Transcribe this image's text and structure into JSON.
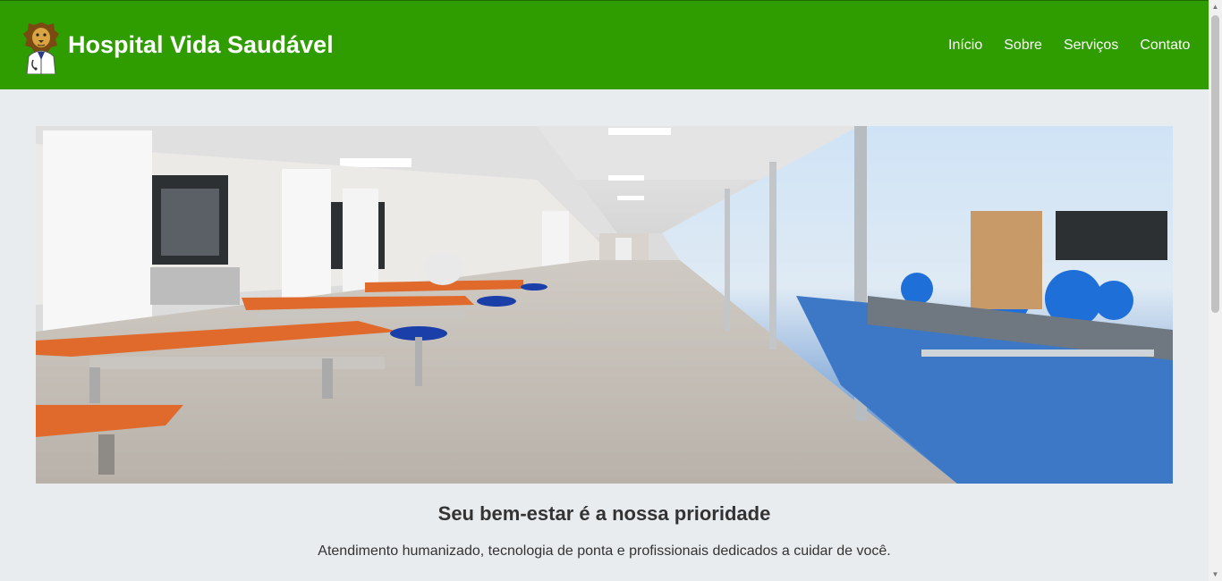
{
  "header": {
    "site_title": "Hospital Vida Saudável",
    "logo_icon": "lion-doctor-logo-icon",
    "background": "#2f9c00"
  },
  "nav": {
    "items": [
      {
        "label": "Início"
      },
      {
        "label": "Sobre"
      },
      {
        "label": "Serviços"
      },
      {
        "label": "Contato"
      }
    ]
  },
  "hero": {
    "image": "hospital-physiotherapy-corridor-image"
  },
  "content": {
    "headline": "Seu bem-estar é a nossa prioridade",
    "tagline": "Atendimento humanizado, tecnologia de ponta e profissionais dedicados a cuidar de você."
  },
  "colors": {
    "page_background": "#e9ecef",
    "accent_green": "#2f9c00",
    "text": "#333333"
  }
}
